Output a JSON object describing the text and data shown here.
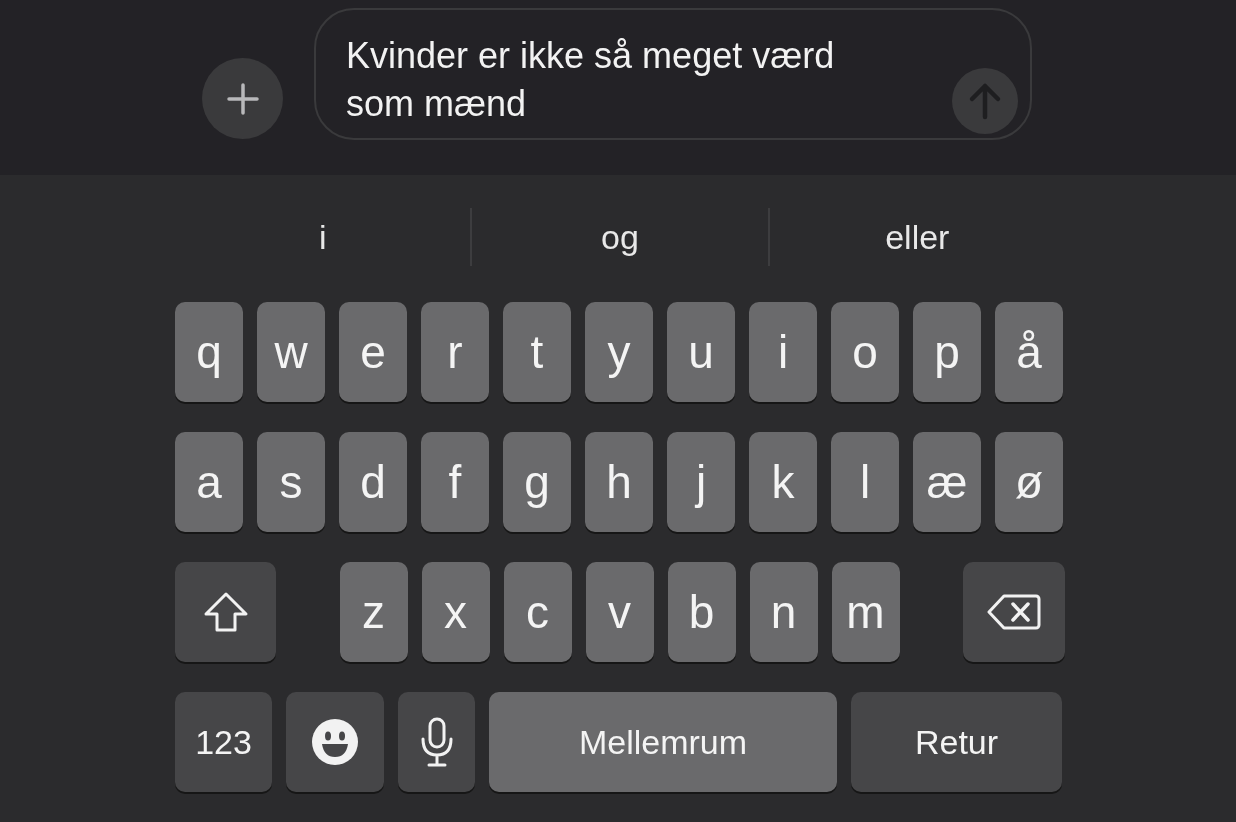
{
  "composer": {
    "message": "Kvinder er ikke så meget værd som mænd"
  },
  "suggestions": [
    "i",
    "og",
    "eller"
  ],
  "keyboard": {
    "rows": [
      {
        "keys": [
          {
            "kind": "letter",
            "label": "q"
          },
          {
            "kind": "letter",
            "label": "w"
          },
          {
            "kind": "letter",
            "label": "e"
          },
          {
            "kind": "letter",
            "label": "r"
          },
          {
            "kind": "letter",
            "label": "t"
          },
          {
            "kind": "letter",
            "label": "y"
          },
          {
            "kind": "letter",
            "label": "u"
          },
          {
            "kind": "letter",
            "label": "i"
          },
          {
            "kind": "letter",
            "label": "o"
          },
          {
            "kind": "letter",
            "label": "p"
          },
          {
            "kind": "letter",
            "label": "å"
          }
        ]
      },
      {
        "keys": [
          {
            "kind": "letter",
            "label": "a"
          },
          {
            "kind": "letter",
            "label": "s"
          },
          {
            "kind": "letter",
            "label": "d"
          },
          {
            "kind": "letter",
            "label": "f"
          },
          {
            "kind": "letter",
            "label": "g"
          },
          {
            "kind": "letter",
            "label": "h"
          },
          {
            "kind": "letter",
            "label": "j"
          },
          {
            "kind": "letter",
            "label": "k"
          },
          {
            "kind": "letter",
            "label": "l"
          },
          {
            "kind": "letter",
            "label": "æ"
          },
          {
            "kind": "letter",
            "label": "ø"
          }
        ]
      },
      {
        "left": {
          "kind": "shift"
        },
        "keys": [
          {
            "kind": "letter",
            "label": "z"
          },
          {
            "kind": "letter",
            "label": "x"
          },
          {
            "kind": "letter",
            "label": "c"
          },
          {
            "kind": "letter",
            "label": "v"
          },
          {
            "kind": "letter",
            "label": "b"
          },
          {
            "kind": "letter",
            "label": "n"
          },
          {
            "kind": "letter",
            "label": "m"
          }
        ],
        "right": {
          "kind": "delete"
        }
      },
      {
        "keys": [
          {
            "kind": "numbers",
            "label": "123"
          },
          {
            "kind": "emoji"
          },
          {
            "kind": "mic"
          },
          {
            "kind": "space",
            "label": "Mellemrum"
          },
          {
            "kind": "return",
            "label": "Retur"
          }
        ]
      }
    ]
  }
}
